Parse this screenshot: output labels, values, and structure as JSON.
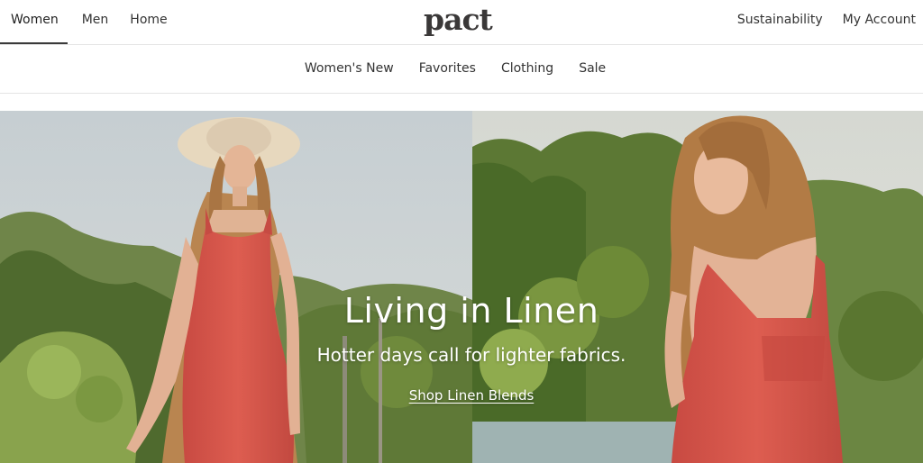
{
  "header": {
    "primary_nav": [
      {
        "label": "Women",
        "active": true
      },
      {
        "label": "Men",
        "active": false
      },
      {
        "label": "Home",
        "active": false
      }
    ],
    "logo_text": "pact",
    "secondary_links": [
      {
        "label": "Sustainability"
      },
      {
        "label": "My Account"
      }
    ]
  },
  "subnav": [
    {
      "label": "Women's New"
    },
    {
      "label": "Favorites"
    },
    {
      "label": "Clothing"
    },
    {
      "label": "Sale"
    }
  ],
  "hero": {
    "title": "Living in Linen",
    "subtitle": "Hotter days call for lighter fabrics.",
    "cta_label": "Shop Linen Blends",
    "colors": {
      "sky_left": "#c9d0d3",
      "sky_right": "#d8dcd8",
      "foliage": "#5f7a3a",
      "dress": "#d4554a",
      "hat": "#e6d7bd",
      "skin": "#e6b89b",
      "hair": "#b7824c",
      "water": "#9fb4b4"
    }
  }
}
